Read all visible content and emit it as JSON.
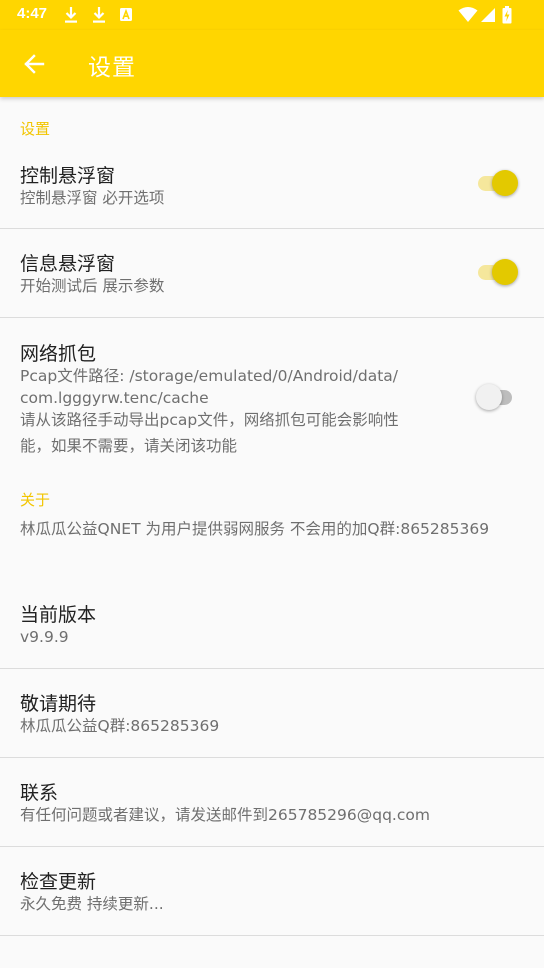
{
  "status_bar": {
    "time": "4:47",
    "left_icons": [
      "download-icon",
      "download-icon",
      "a-box-icon"
    ],
    "right_icons": [
      "wifi-icon",
      "cell-signal-icon",
      "battery-charging-icon"
    ]
  },
  "app_bar": {
    "title": "设置",
    "back_icon": "arrow-back-icon"
  },
  "settings": {
    "category": "设置",
    "float_control": {
      "title": "控制悬浮窗",
      "summary": "控制悬浮窗 必开选项",
      "enabled": true
    },
    "float_info": {
      "title": "信息悬浮窗",
      "summary": "开始测试后 展示参数",
      "enabled": true
    },
    "capture": {
      "title": "网络抓包",
      "summary_line1": "Pcap文件路径: /storage/emulated/0/Android/data/",
      "summary_line2": "com.lgggyrw.tenc/cache",
      "summary_line3": "请从该路径手动导出pcap文件，网络抓包可能会影响性",
      "summary_line4": "能，如果不需要，请关闭该功能",
      "enabled": false
    }
  },
  "about": {
    "category": "关于",
    "intro": "林瓜瓜公益QNET 为用户提供弱网服务 不会用的加Q群:865285369",
    "version": {
      "title": "当前版本",
      "summary": "v9.9.9"
    },
    "stay_tuned": {
      "title": "敬请期待",
      "summary": "林瓜瓜公益Q群:865285369"
    },
    "contact": {
      "title": "联系",
      "summary": "有任何问题或者建议，请发送邮件到265785296@qq.com"
    },
    "update": {
      "title": "检查更新",
      "summary": "永久免费 持续更新..."
    }
  },
  "colors": {
    "primary": "#ffd600",
    "accent": "#f2c500",
    "switch_on": "#e3c900",
    "text_primary": "#212121",
    "text_secondary": "#6f6f6f"
  }
}
